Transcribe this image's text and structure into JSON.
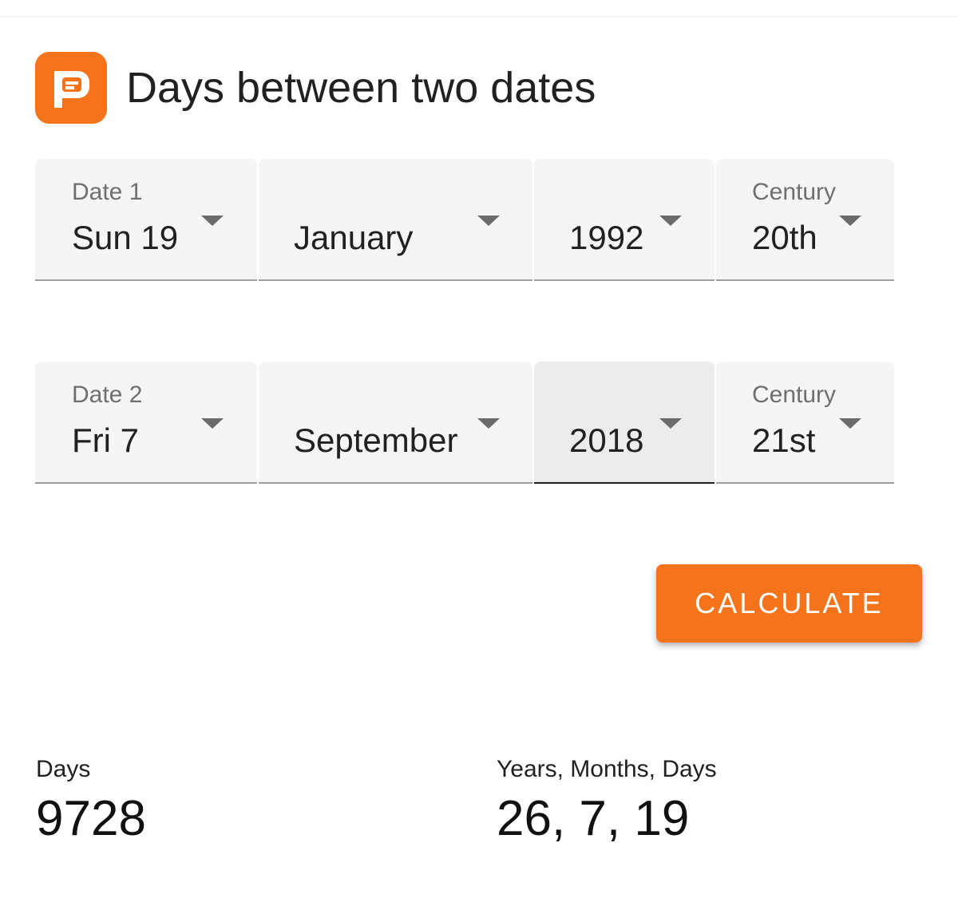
{
  "app": {
    "title": "Days between two dates",
    "icon": "app-logo-icon",
    "accent_color": "#f5731a"
  },
  "date1": {
    "label": "Date 1",
    "day": "Sun 19",
    "month": "January",
    "year": "1992",
    "century_label": "Century",
    "century": "20th"
  },
  "date2": {
    "label": "Date 2",
    "day": "Fri 7",
    "month": "September",
    "year": "2018",
    "century_label": "Century",
    "century": "21st"
  },
  "actions": {
    "calculate_label": "CALCULATE"
  },
  "results": {
    "days_label": "Days",
    "days_value": "9728",
    "ymd_label": "Years, Months, Days",
    "ymd_value": "26, 7, 19"
  }
}
